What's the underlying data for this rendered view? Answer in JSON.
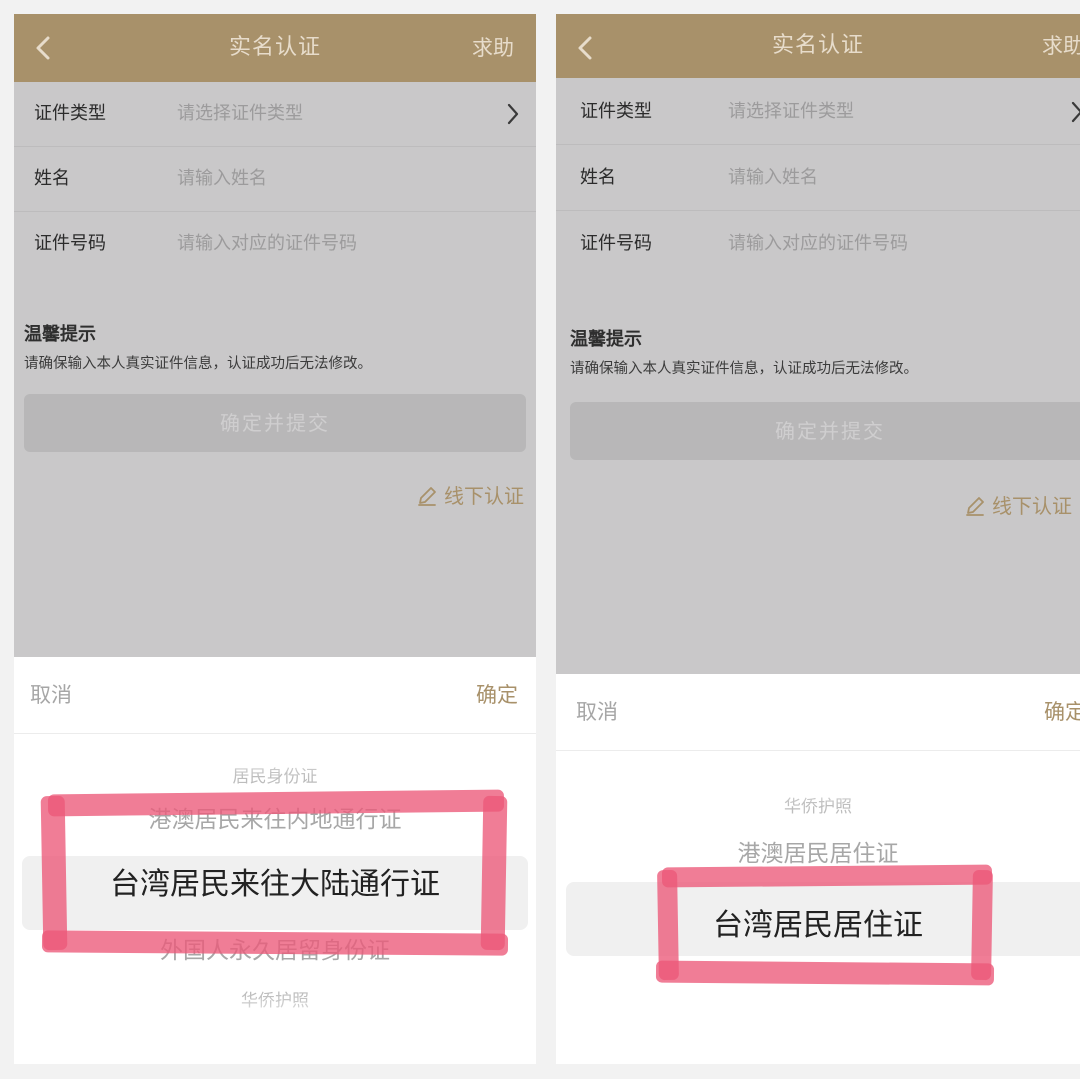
{
  "header": {
    "title": "实名认证",
    "help": "求助"
  },
  "form": {
    "id_type_label": "证件类型",
    "id_type_placeholder": "请选择证件类型",
    "name_label": "姓名",
    "name_placeholder": "请输入姓名",
    "id_number_label": "证件号码",
    "id_number_placeholder": "请输入对应的证件号码"
  },
  "tips": {
    "title": "温馨提示",
    "body": "请确保输入本人真实证件信息，认证成功后无法修改。"
  },
  "submit_label": "确定并提交",
  "offline_label": "线下认证",
  "picker": {
    "cancel": "取消",
    "confirm": "确定"
  },
  "left_picker": {
    "items": [
      "居民身份证",
      "港澳居民来往内地通行证",
      "台湾居民来往大陆通行证",
      "外国人永久居留身份证",
      "华侨护照"
    ],
    "selected_index": 2
  },
  "right_picker": {
    "items": [
      "华侨护照",
      "港澳居民居住证",
      "台湾居民居住证"
    ],
    "selected_index": 2
  },
  "colors": {
    "brand": "#a8916a",
    "overlay": "#c9c8c9",
    "highlight": "#ec5878"
  }
}
